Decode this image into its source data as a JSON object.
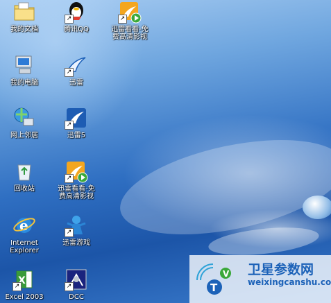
{
  "desktop": {
    "icons": [
      {
        "id": "my-documents",
        "label": "我的文档",
        "icon": "folder-documents-icon"
      },
      {
        "id": "tencent-qq",
        "label": "腾讯QQ",
        "icon": "qq-penguin-icon",
        "shortcut": true
      },
      {
        "id": "xunlei-kankan-top",
        "label": "迅雷看看-免\n费高清影视",
        "icon": "xunlei-kankan-icon",
        "shortcut": true
      },
      {
        "id": "my-computer",
        "label": "我的电脑",
        "icon": "computer-icon"
      },
      {
        "id": "xunlei",
        "label": "迅雷",
        "icon": "xunlei-bird-icon",
        "shortcut": true
      },
      {
        "id": "network-places",
        "label": "网上邻居",
        "icon": "network-icon"
      },
      {
        "id": "xunlei5",
        "label": "迅雷5",
        "icon": "xunlei5-icon",
        "shortcut": true
      },
      {
        "id": "recycle-bin",
        "label": "回收站",
        "icon": "recycle-bin-icon"
      },
      {
        "id": "xunlei-kankan",
        "label": "迅雷看看-免\n费高清影视",
        "icon": "xunlei-kankan-icon",
        "shortcut": true
      },
      {
        "id": "internet-explorer",
        "label": "Internet\nExplorer",
        "icon": "ie-icon"
      },
      {
        "id": "xunlei-games",
        "label": "迅雷游戏",
        "icon": "xunlei-games-icon",
        "shortcut": true
      },
      {
        "id": "excel-2003",
        "label": "Excel 2003",
        "icon": "excel-icon",
        "shortcut": true
      },
      {
        "id": "dcc",
        "label": "DCC",
        "icon": "dcc-icon",
        "shortcut": true
      }
    ]
  },
  "watermark": {
    "title": "卫星参数网",
    "url": "weixingcanshu.com"
  },
  "colors": {
    "desktop_blue": "#2f6fc2",
    "watermark_blue": "#1c62b8"
  }
}
